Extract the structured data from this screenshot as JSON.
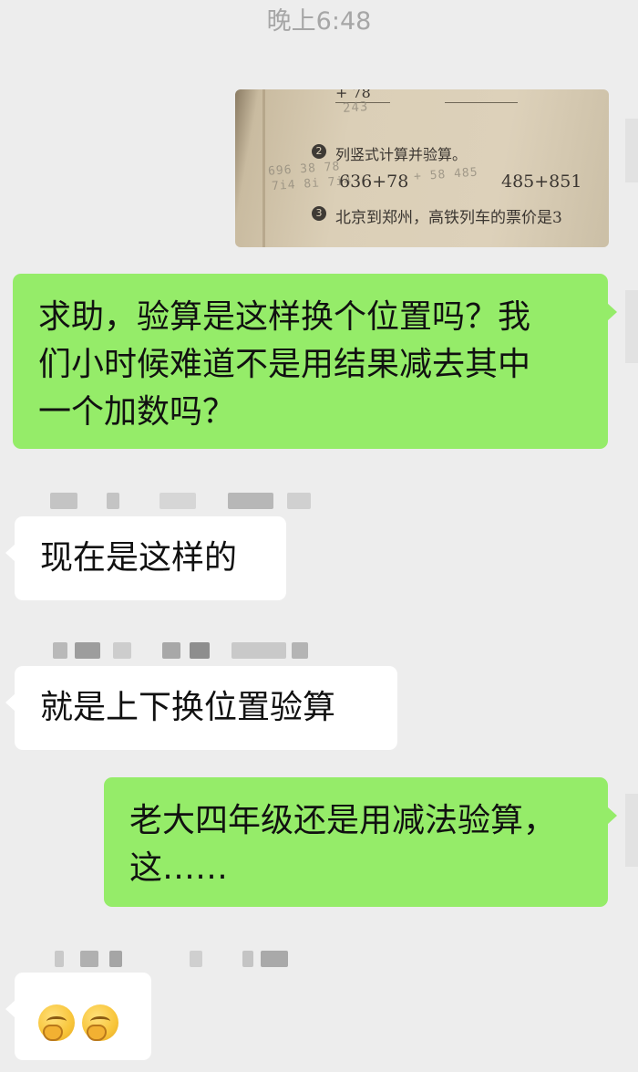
{
  "header": {
    "timestamp": "晚上6:48"
  },
  "photo": {
    "icon": "homework-photo",
    "q2_title": "列竖式计算并验算。",
    "q2_expr1": "636+78",
    "q2_expr2": "485+851",
    "q3_text": "北京到郑州，高铁列车的票价是3",
    "num_top1": "+ 78",
    "num_top2": "243",
    "q2_num": "2",
    "q3_num": "3"
  },
  "messages": [
    {
      "side": "right",
      "lines": [
        "求助，验算是这样换个位置吗？我",
        "们小时候难道不是用结果减去其中",
        "一个加数吗？"
      ]
    },
    {
      "side": "left",
      "lines": [
        "现在是这样的"
      ]
    },
    {
      "side": "left",
      "lines": [
        "就是上下换位置验算"
      ]
    },
    {
      "side": "right",
      "lines": [
        "老大四年级还是用减法验算，",
        "这……"
      ]
    },
    {
      "side": "left",
      "emojis": [
        "grimace-emoji",
        "grimace-emoji"
      ]
    }
  ]
}
